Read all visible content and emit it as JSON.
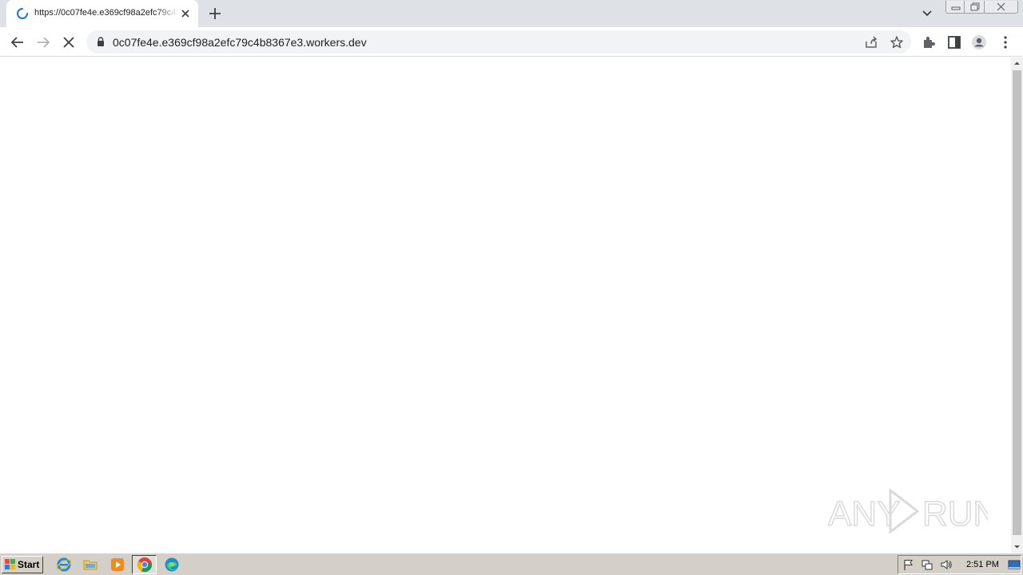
{
  "browser": {
    "tab": {
      "title": "https://0c07fe4e.e369cf98a2efc79c4b8367e3.workers.dev",
      "state": "loading"
    },
    "address_bar": {
      "url": "0c07fe4e.e369cf98a2efc79c4b8367e3.workers.dev",
      "secure": true
    },
    "nav": {
      "back_enabled": true,
      "forward_enabled": false,
      "reload_state": "stop"
    },
    "icons": [
      "back-icon",
      "forward-icon",
      "stop-icon",
      "lock-icon",
      "share-icon",
      "star-icon",
      "extensions-icon",
      "side-panel-icon",
      "profile-icon",
      "menu-icon",
      "tab-search-icon",
      "new-tab-icon"
    ]
  },
  "watermark": {
    "text": "ANY RUN"
  },
  "taskbar": {
    "start_label": "Start",
    "quick_launch": [
      "internet-explorer-icon",
      "folder-icon",
      "media-player-icon",
      "chrome-icon",
      "edge-icon"
    ],
    "active_app": "chrome-icon",
    "tray_icons": [
      "flag-icon",
      "network-icon",
      "volume-icon"
    ],
    "clock": "2:51 PM"
  },
  "colors": {
    "tabstrip": "#dee1e6",
    "omnibox": "#f1f3f4",
    "taskbar": "#d4d0c8",
    "spinner": "#1a73e8"
  }
}
